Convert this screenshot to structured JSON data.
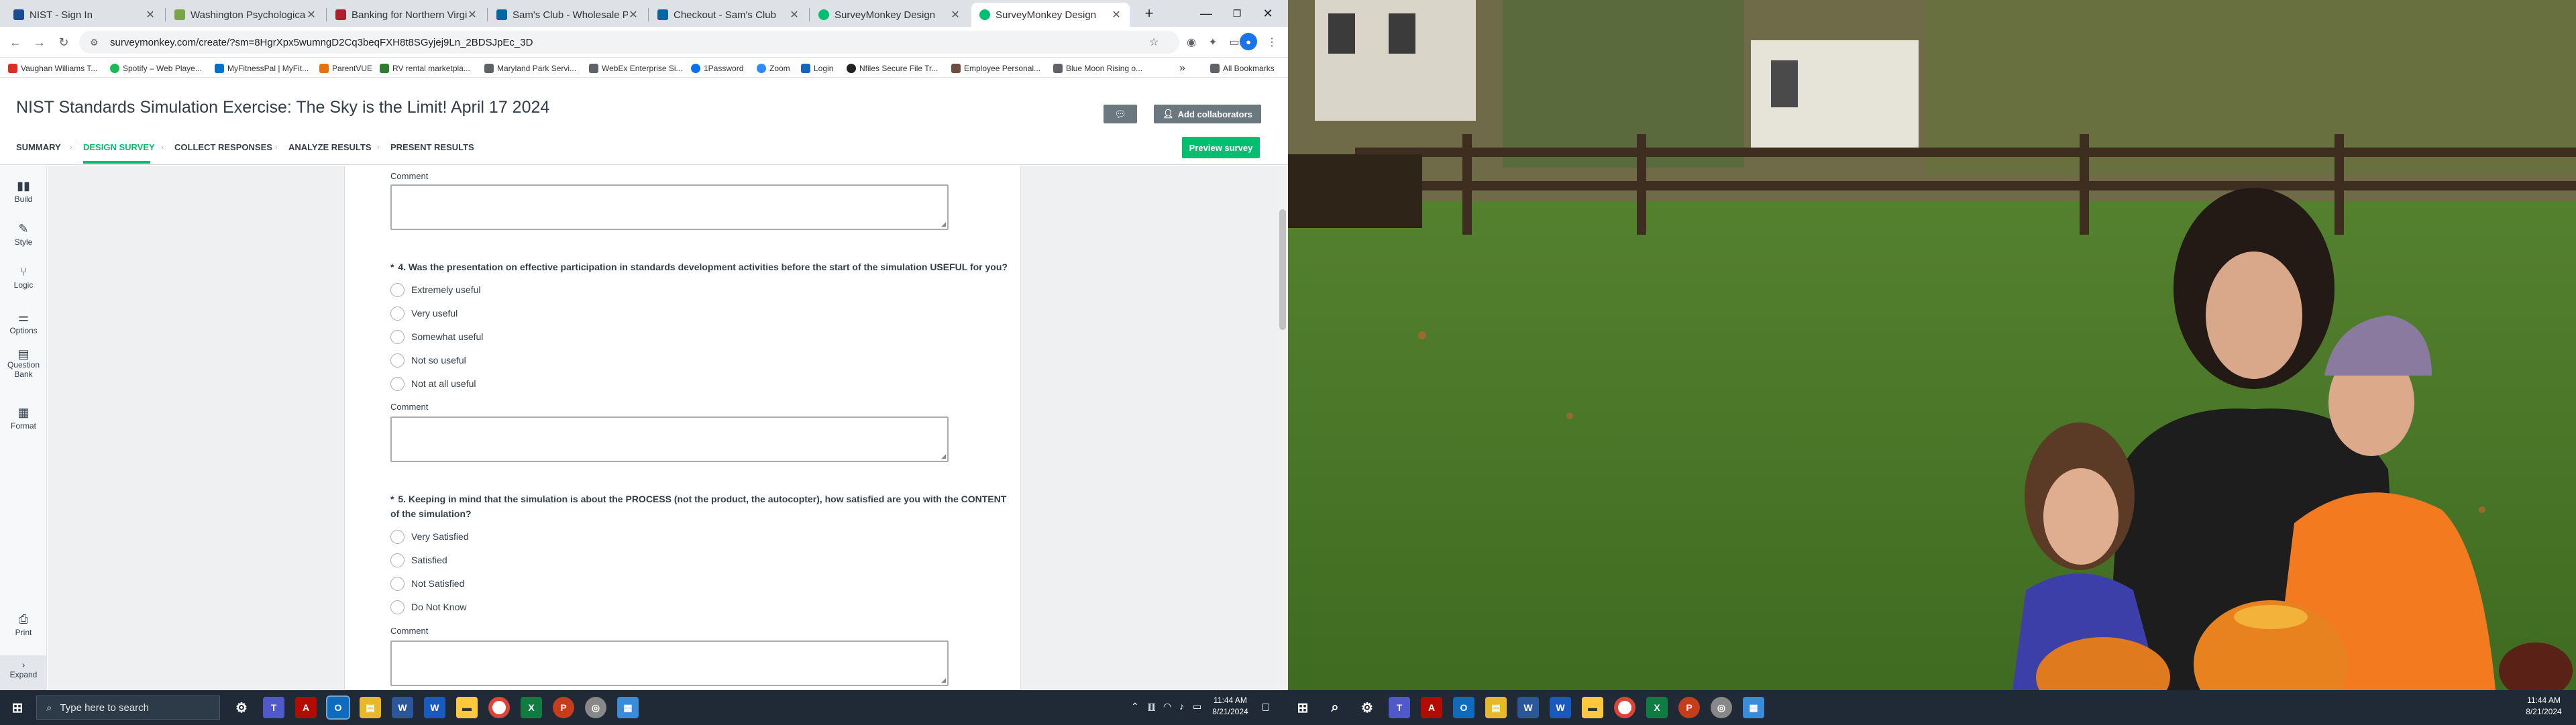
{
  "browser": {
    "tabs": [
      {
        "label": "NIST - Sign In",
        "color": "#1a4d8f"
      },
      {
        "label": "Washington Psychological Wel",
        "color": "#7aa34a"
      },
      {
        "label": "Banking for Northern Virginia",
        "color": "#b01e2e"
      },
      {
        "label": "Sam's Club - Wholesale Prices",
        "color": "#0067a0"
      },
      {
        "label": "Checkout - Sam's Club",
        "color": "#0067a0"
      },
      {
        "label": "SurveyMonkey Design",
        "color": "#00bf6f"
      },
      {
        "label": "SurveyMonkey Design",
        "color": "#00bf6f"
      }
    ],
    "new_tab": "+",
    "url": "surveymonkey.com/create/?sm=8HgrXpx5wumngD2Cq3beqFXH8t8SGyjej9Ln_2BDSJpEc_3D",
    "bookmarks": [
      {
        "label": "Vaughan Williams T...",
        "color": "#d93025"
      },
      {
        "label": "Spotify – Web Playe...",
        "color": "#1db954"
      },
      {
        "label": "MyFitnessPal | MyFit...",
        "color": "#0070c9"
      },
      {
        "label": "ParentVUE",
        "color": "#e8710a"
      },
      {
        "label": "RV rental marketpla...",
        "color": "#2e7d32"
      },
      {
        "label": "Maryland Park Servi...",
        "color": "#5f6368"
      },
      {
        "label": "WebEx Enterprise Si...",
        "color": "#5f6368"
      },
      {
        "label": "1Password",
        "color": "#0572ec"
      },
      {
        "label": "Zoom",
        "color": "#2d8cff"
      },
      {
        "label": "Login",
        "color": "#1565c0"
      },
      {
        "label": "Nfiles Secure File Tr...",
        "color": "#222222"
      },
      {
        "label": "Employee Personal...",
        "color": "#6d4c41"
      },
      {
        "label": "Blue Moon Rising o...",
        "color": "#5f6368"
      }
    ],
    "more_bookmarks": "»",
    "all_bookmarks": "All Bookmarks"
  },
  "app": {
    "survey_title": "NIST Standards Simulation Exercise: The Sky is the Limit! April 17 2024",
    "add_collaborators": "Add collaborators",
    "preview_survey": "Preview survey",
    "nav": [
      "SUMMARY",
      "DESIGN SURVEY",
      "COLLECT RESPONSES",
      "ANALYZE RESULTS",
      "PRESENT RESULTS"
    ],
    "nav_separator": "›",
    "rail": [
      "Build",
      "Style",
      "Logic",
      "Options",
      "Question Bank",
      "Format",
      "Print",
      "Expand"
    ]
  },
  "survey": {
    "comment_label": "Comment",
    "q4": {
      "title": "4. Was the presentation on effective participation in standards development activities before the start of the simulation USEFUL for you?",
      "options": [
        "Extremely useful",
        "Very useful",
        "Somewhat useful",
        "Not so useful",
        "Not at all useful"
      ]
    },
    "q5": {
      "title": "5. Keeping in mind that the simulation is about the PROCESS (not the product, the autocopter), how satisfied are you with the CONTENT of the simulation?",
      "options": [
        "Very Satisfied",
        "Satisfied",
        "Not Satisfied",
        "Do Not Know"
      ]
    },
    "required_marker": "*"
  },
  "taskbar": {
    "search_placeholder": "Type here to search",
    "time": "11:44 AM",
    "date": "8/21/2024"
  },
  "colors": {
    "brand_green": "#00bf6f",
    "taskbar": "#1f2a36"
  }
}
